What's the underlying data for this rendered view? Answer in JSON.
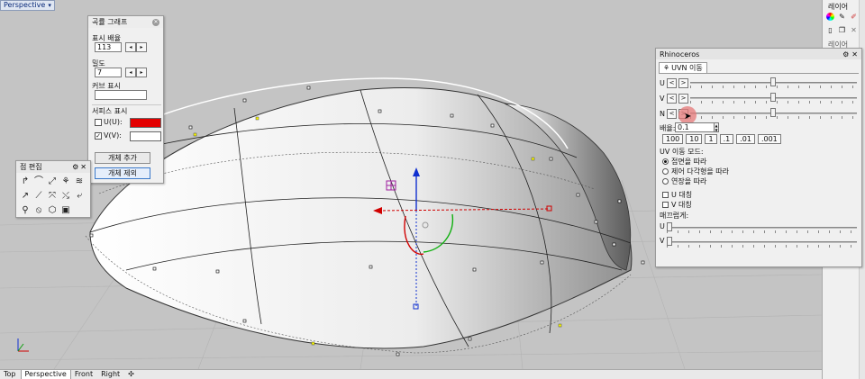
{
  "viewport": {
    "label": "Perspective",
    "colors": {
      "background": "#c4c4c4",
      "accent_red": "#e00000",
      "accent_blue": "#1030d0",
      "accent_green": "#10b010"
    }
  },
  "bottom_tabs": [
    {
      "label": "Top",
      "active": false
    },
    {
      "label": "Perspective",
      "active": true
    },
    {
      "label": "Front",
      "active": false
    },
    {
      "label": "Right",
      "active": false
    }
  ],
  "right_strip": {
    "title": "레이어",
    "second_tab": "레이어",
    "icons": [
      "color-wheel-icon",
      "paint-icon",
      "pencil-icon",
      "new-doc-icon",
      "copy-icon",
      "delete-icon"
    ]
  },
  "curvature_panel": {
    "title": "곡률 그래프",
    "scale_label": "표시 배율",
    "scale_value": "113",
    "density_label": "밀도",
    "density_value": "7",
    "curve_label": "커브 표시",
    "surface_label": "서피스 표시",
    "u_label": "U(U):",
    "v_label": "V(V):",
    "u_checked": false,
    "v_checked": true,
    "u_color": "#e30000",
    "v_color": "#ffffff",
    "add_button": "개체 추가",
    "remove_button": "개체 제외"
  },
  "point_edit_panel": {
    "title": "점 편집"
  },
  "uvn_panel": {
    "title": "Rhinoceros",
    "tab": "UVN 이동",
    "axes": [
      {
        "label": "U",
        "slider": 0.5
      },
      {
        "label": "V",
        "slider": 0.5
      },
      {
        "label": "N",
        "slider": 0.5
      }
    ],
    "scale_label": "배율:",
    "scale_value": "0.1",
    "steps": [
      "100",
      "10",
      "1",
      ".1",
      ".01",
      ".001"
    ],
    "mode_label": "UV 이동 모드:",
    "modes": [
      {
        "label": "접면을 따라",
        "selected": true
      },
      {
        "label": "제어 다각형을 따라",
        "selected": false
      },
      {
        "label": "연장을 따라",
        "selected": false
      }
    ],
    "u_sym": "U 대칭",
    "v_sym": "V 대칭",
    "blend_label": "매끄럽게:",
    "blend_u": "U",
    "blend_v": "V",
    "btn_left": "<",
    "btn_right": ">"
  }
}
